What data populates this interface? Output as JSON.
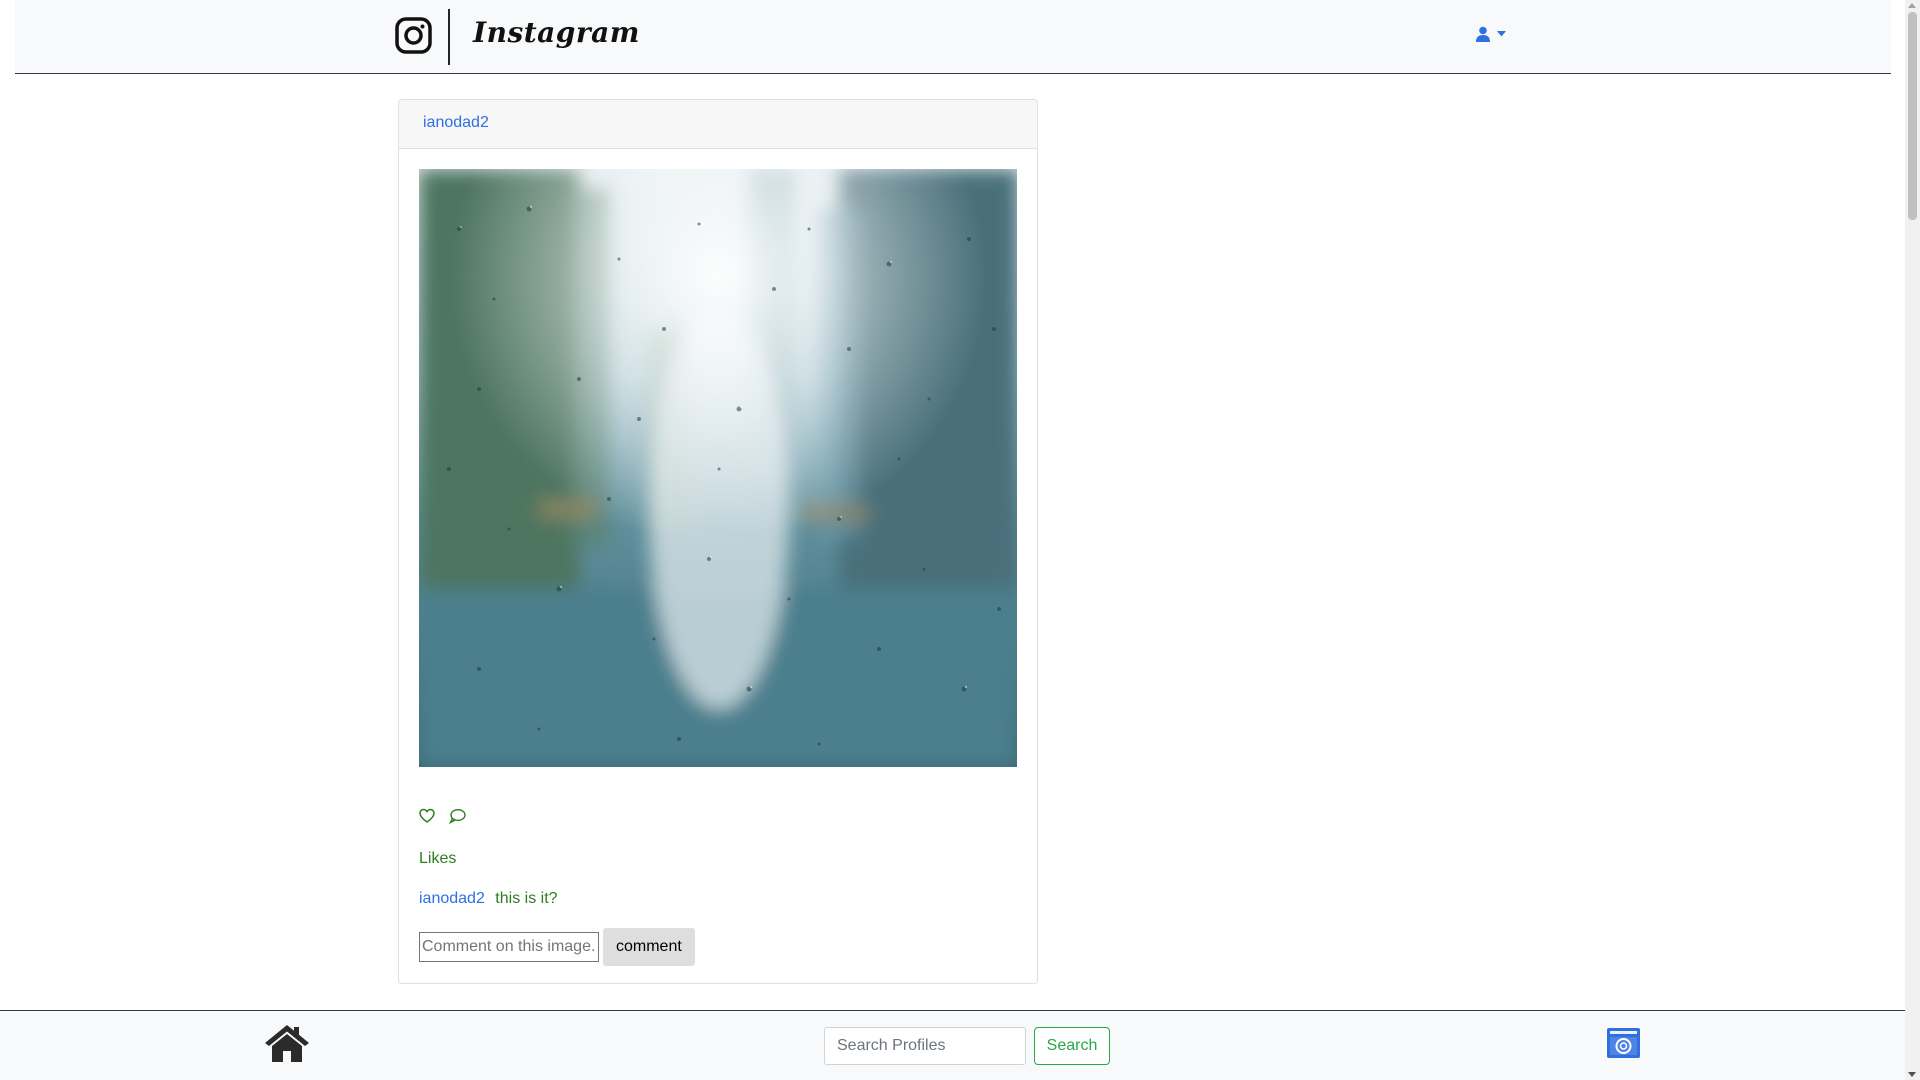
{
  "navbar": {
    "brand_name": "Instagram",
    "brand_icon": "instagram-logo-icon",
    "user_icon": "user-icon",
    "user_dropdown_icon": "caret-down-icon",
    "accent_color": "#2f6fe0"
  },
  "post": {
    "author": "ianodad2",
    "image_description_icon": "rain-window-photo",
    "like_icon": "heart-outline-icon",
    "comment_icon": "chat-bubble-icon",
    "likes_label": "Likes",
    "comments": [
      {
        "author": "ianodad2",
        "text": "this is it?"
      }
    ],
    "comment_placeholder": "Comment on this image..",
    "comment_button_label": "comment"
  },
  "footer": {
    "home_icon": "home-icon",
    "search_placeholder": "Search Profiles",
    "search_button_label": "Search",
    "upload_icon": "camera-upload-icon",
    "search_color": "#28a745"
  }
}
